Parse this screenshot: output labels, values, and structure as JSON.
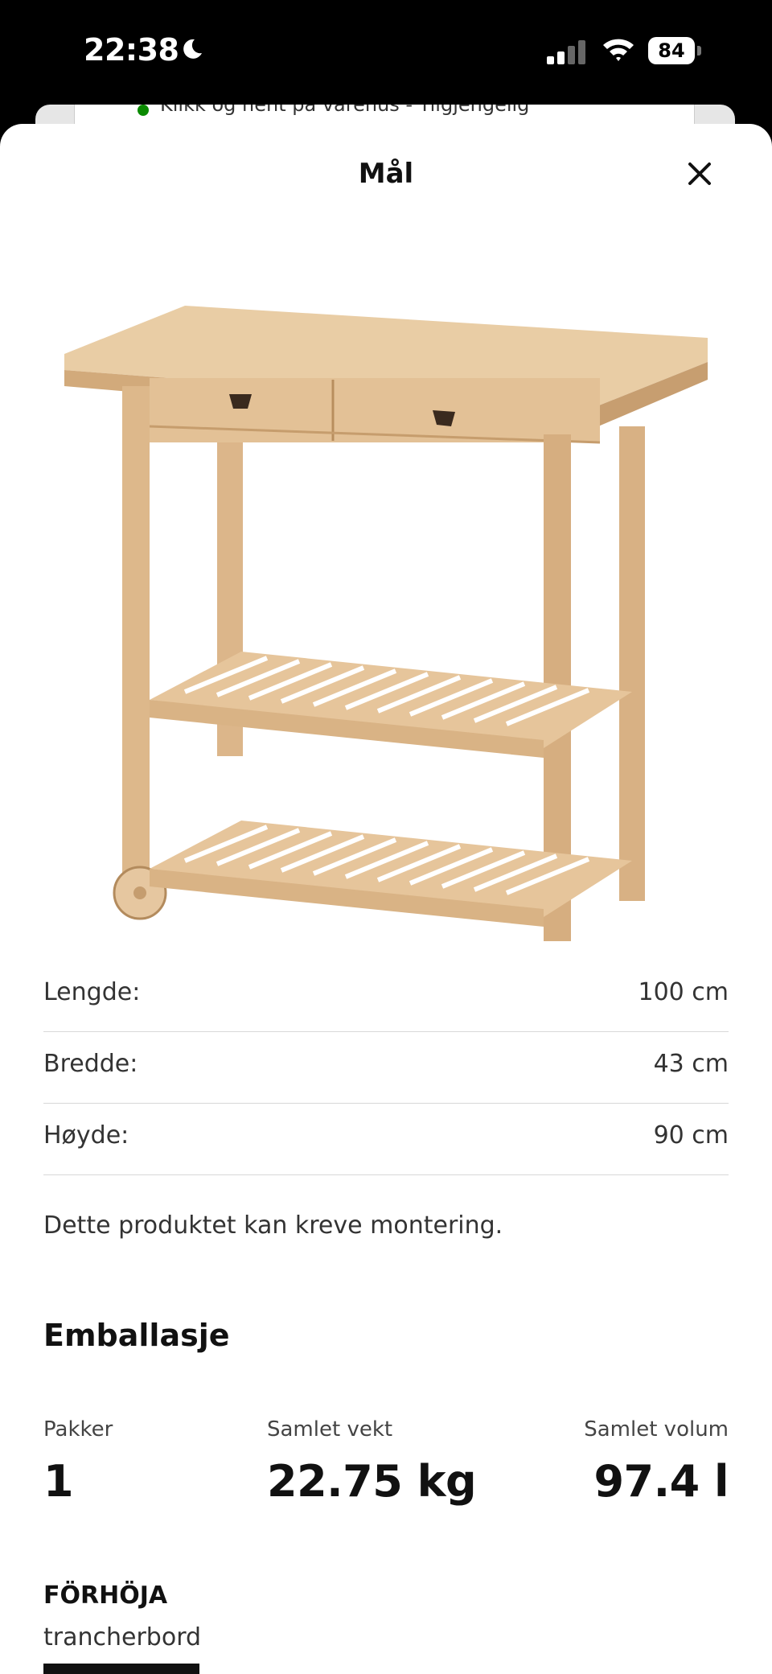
{
  "status_bar": {
    "time": "22:38",
    "battery": "84",
    "icons": [
      "moon-icon",
      "signal-icon",
      "wifi-icon",
      "battery-icon"
    ]
  },
  "background_sheet": {
    "text": "Klikk og hent på varehus - Tilgjengelig",
    "status_color": "#0a8a00"
  },
  "sheet": {
    "title": "Mål",
    "close_icon": "close-icon"
  },
  "dimensions": [
    {
      "label": "Lengde:",
      "value": "100 cm"
    },
    {
      "label": "Bredde:",
      "value": "43 cm"
    },
    {
      "label": "Høyde:",
      "value": "90 cm"
    }
  ],
  "assembly_note": "Dette produktet kan kreve montering.",
  "packaging": {
    "heading": "Emballasje",
    "packages_label": "Pakker",
    "packages_value": "1",
    "weight_label": "Samlet vekt",
    "weight_value": "22.75 kg",
    "volume_label": "Samlet volum",
    "volume_value": "97.4 l"
  },
  "product": {
    "name": "FÖRHÖJA",
    "type": "trancherbord"
  }
}
